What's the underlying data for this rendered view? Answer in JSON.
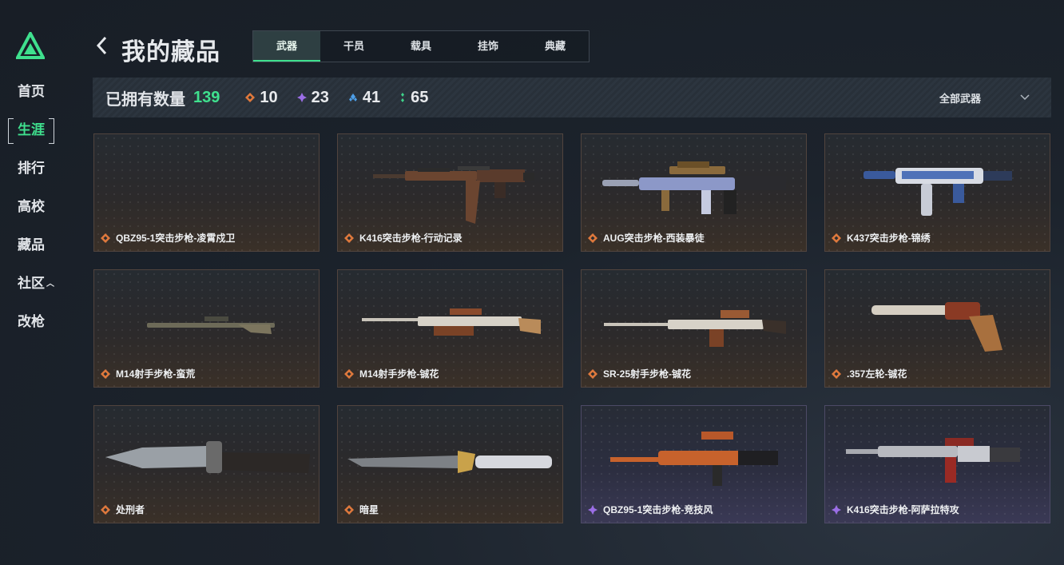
{
  "nav": [
    "首页",
    "生涯",
    "排行",
    "高校",
    "藏品",
    "社区",
    "改枪"
  ],
  "nav_caret": "^",
  "title": "我的藏品",
  "tabs": [
    "武器",
    "干员",
    "载具",
    "挂饰",
    "典藏"
  ],
  "stats": {
    "owned_label": "已拥有数量",
    "owned_count": "139",
    "by_rarity": [
      {
        "icon": "orange-diamond-icon",
        "color": "#e0793c",
        "value": "10"
      },
      {
        "icon": "purple-diamond-icon",
        "color": "#9b6ee6",
        "value": "23"
      },
      {
        "icon": "blue-diamond-icon",
        "color": "#4d9fe8",
        "value": "41"
      },
      {
        "icon": "green-dots-icon",
        "color": "#3fd28a",
        "value": "65"
      }
    ]
  },
  "filter": {
    "label": "全部武器",
    "icon": "chevron-down-icon"
  },
  "colors": {
    "accent": "#3fe08e",
    "orange_rarity": "#e0793c",
    "purple_rarity": "#9b6ee6"
  },
  "items": [
    {
      "name": "QBZ95-1突击步枪-凌霄戍卫",
      "rarity": "orange"
    },
    {
      "name": "K416突击步枪-行动记录",
      "rarity": "orange"
    },
    {
      "name": "AUG突击步枪-西装暴徒",
      "rarity": "orange"
    },
    {
      "name": "K437突击步枪-锦绣",
      "rarity": "orange"
    },
    {
      "name": "M14射手步枪-蛮荒",
      "rarity": "orange"
    },
    {
      "name": "M14射手步枪-铖花",
      "rarity": "orange"
    },
    {
      "name": "SR-25射手步枪-铖花",
      "rarity": "orange"
    },
    {
      "name": ".357左轮-铖花",
      "rarity": "orange"
    },
    {
      "name": "处刑者",
      "rarity": "orange"
    },
    {
      "name": "暗星",
      "rarity": "orange"
    },
    {
      "name": "QBZ95-1突击步枪-竞技风",
      "rarity": "purple"
    },
    {
      "name": "K416突击步枪-阿萨拉特攻",
      "rarity": "purple"
    }
  ]
}
